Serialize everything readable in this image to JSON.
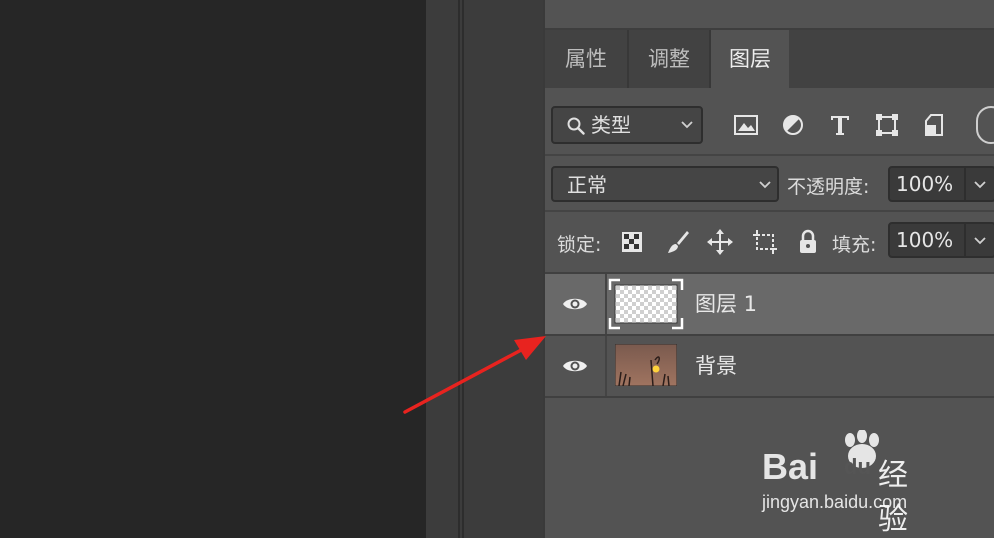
{
  "panel": {
    "tabs": [
      {
        "label": "属性"
      },
      {
        "label": "调整"
      },
      {
        "label": "图层"
      }
    ],
    "filter": {
      "kind_label": "类型"
    },
    "blend": {
      "mode": "正常",
      "opacity_label": "不透明度:",
      "opacity_value": "100%"
    },
    "lock": {
      "label": "锁定:",
      "fill_label": "填充:",
      "fill_value": "100%"
    },
    "layers": [
      {
        "name": "图层 1",
        "selected": true
      },
      {
        "name": "背景",
        "selected": false
      }
    ]
  },
  "watermark": {
    "brand": "Bai",
    "brand_cn": "经验",
    "url": "jingyan.baidu.com"
  },
  "colors": {
    "panel_bg": "#535353",
    "selected_layer": "#696969",
    "arrow": "#e8231f",
    "canvas": "#262626"
  }
}
